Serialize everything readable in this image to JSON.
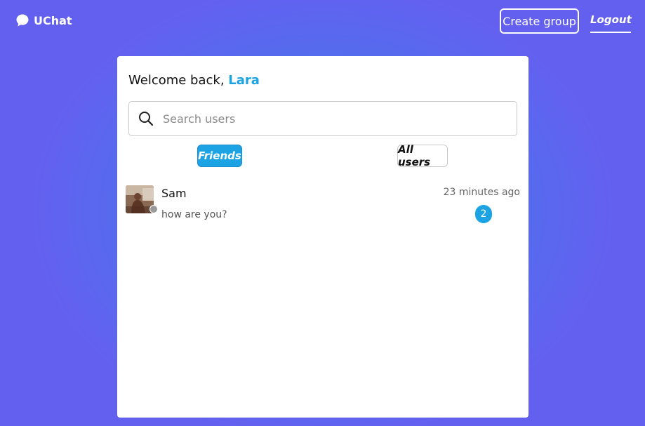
{
  "app": {
    "brand_name": "UChat",
    "brand_icon": "chat-bubble-icon"
  },
  "header": {
    "create_group_label": "Create group",
    "logout_label": "Logout"
  },
  "welcome": {
    "prefix": "Welcome back, ",
    "username": "Lara"
  },
  "search": {
    "placeholder": "Search users",
    "value": "",
    "icon": "search-icon"
  },
  "tabs": [
    {
      "label": "Friends",
      "active": true
    },
    {
      "label": "All users",
      "active": false
    }
  ],
  "chats": [
    {
      "name": "Sam",
      "last_message": "how are you?",
      "time": "23 minutes ago",
      "unread": "2",
      "status": "offline"
    }
  ],
  "colors": {
    "accent": "#1ba3e3",
    "background_start": "#3f80ef",
    "background_end": "#6460ef",
    "status_offline": "#9a9a9a"
  }
}
